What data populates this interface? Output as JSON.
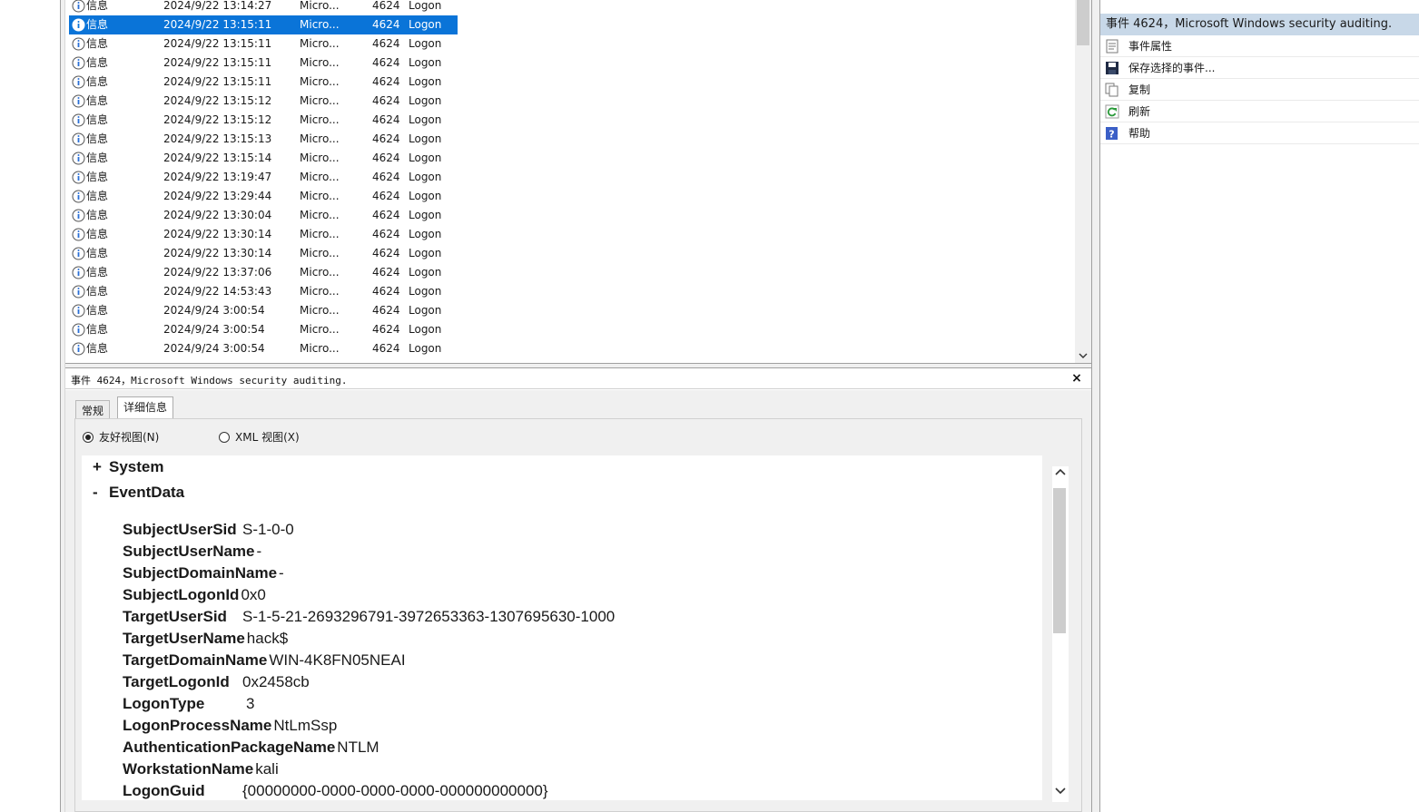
{
  "event_list": {
    "rows": [
      {
        "level": "信息",
        "date": "2024/9/22 13:14:27",
        "source": "Micro...",
        "event_id": "4624",
        "task": "Logon",
        "selected": false
      },
      {
        "level": "信息",
        "date": "2024/9/22 13:15:11",
        "source": "Micro...",
        "event_id": "4624",
        "task": "Logon",
        "selected": true
      },
      {
        "level": "信息",
        "date": "2024/9/22 13:15:11",
        "source": "Micro...",
        "event_id": "4624",
        "task": "Logon",
        "selected": false
      },
      {
        "level": "信息",
        "date": "2024/9/22 13:15:11",
        "source": "Micro...",
        "event_id": "4624",
        "task": "Logon",
        "selected": false
      },
      {
        "level": "信息",
        "date": "2024/9/22 13:15:11",
        "source": "Micro...",
        "event_id": "4624",
        "task": "Logon",
        "selected": false
      },
      {
        "level": "信息",
        "date": "2024/9/22 13:15:12",
        "source": "Micro...",
        "event_id": "4624",
        "task": "Logon",
        "selected": false
      },
      {
        "level": "信息",
        "date": "2024/9/22 13:15:12",
        "source": "Micro...",
        "event_id": "4624",
        "task": "Logon",
        "selected": false
      },
      {
        "level": "信息",
        "date": "2024/9/22 13:15:13",
        "source": "Micro...",
        "event_id": "4624",
        "task": "Logon",
        "selected": false
      },
      {
        "level": "信息",
        "date": "2024/9/22 13:15:14",
        "source": "Micro...",
        "event_id": "4624",
        "task": "Logon",
        "selected": false
      },
      {
        "level": "信息",
        "date": "2024/9/22 13:19:47",
        "source": "Micro...",
        "event_id": "4624",
        "task": "Logon",
        "selected": false
      },
      {
        "level": "信息",
        "date": "2024/9/22 13:29:44",
        "source": "Micro...",
        "event_id": "4624",
        "task": "Logon",
        "selected": false
      },
      {
        "level": "信息",
        "date": "2024/9/22 13:30:04",
        "source": "Micro...",
        "event_id": "4624",
        "task": "Logon",
        "selected": false
      },
      {
        "level": "信息",
        "date": "2024/9/22 13:30:14",
        "source": "Micro...",
        "event_id": "4624",
        "task": "Logon",
        "selected": false
      },
      {
        "level": "信息",
        "date": "2024/9/22 13:30:14",
        "source": "Micro...",
        "event_id": "4624",
        "task": "Logon",
        "selected": false
      },
      {
        "level": "信息",
        "date": "2024/9/22 13:37:06",
        "source": "Micro...",
        "event_id": "4624",
        "task": "Logon",
        "selected": false
      },
      {
        "level": "信息",
        "date": "2024/9/22 14:53:43",
        "source": "Micro...",
        "event_id": "4624",
        "task": "Logon",
        "selected": false
      },
      {
        "level": "信息",
        "date": "2024/9/24 3:00:54",
        "source": "Micro...",
        "event_id": "4624",
        "task": "Logon",
        "selected": false
      },
      {
        "level": "信息",
        "date": "2024/9/24 3:00:54",
        "source": "Micro...",
        "event_id": "4624",
        "task": "Logon",
        "selected": false
      },
      {
        "level": "信息",
        "date": "2024/9/24 3:00:54",
        "source": "Micro...",
        "event_id": "4624",
        "task": "Logon",
        "selected": false
      }
    ]
  },
  "detail": {
    "title": "事件 4624，Microsoft Windows security auditing.",
    "close_label": "×",
    "tabs": [
      "常规",
      "详细信息"
    ],
    "views": {
      "friendly": "友好视图(N)",
      "xml": "XML 视图(X)"
    },
    "tree": {
      "system": {
        "toggle": "+",
        "label": "System"
      },
      "eventdata": {
        "toggle": "-",
        "label": "EventData"
      }
    },
    "fields": [
      {
        "name": "SubjectUserSid",
        "value": "S-1-0-0"
      },
      {
        "name": "SubjectUserName",
        "value": "-"
      },
      {
        "name": "SubjectDomainName",
        "value": "-"
      },
      {
        "name": "SubjectLogonId",
        "value": "0x0"
      },
      {
        "name": "TargetUserSid",
        "value": "S-1-5-21-2693296791-3972653363-1307695630-1000"
      },
      {
        "name": "TargetUserName",
        "value": "hack$"
      },
      {
        "name": "TargetDomainName",
        "value": "WIN-4K8FN05NEAI"
      },
      {
        "name": "TargetLogonId",
        "value": "0x2458cb"
      },
      {
        "name": "LogonType",
        "value": "3"
      },
      {
        "name": "LogonProcessName",
        "value": "NtLmSsp"
      },
      {
        "name": "AuthenticationPackageName",
        "value": "NTLM"
      },
      {
        "name": "WorkstationName",
        "value": "kali"
      },
      {
        "name": "LogonGuid",
        "value": "{00000000-0000-0000-0000-000000000000}"
      }
    ]
  },
  "actions": {
    "section_title": "事件 4624，Microsoft Windows security auditing.",
    "items": [
      {
        "label": "事件属性",
        "icon": "properties-icon"
      },
      {
        "label": "保存选择的事件...",
        "icon": "save-icon"
      },
      {
        "label": "复制",
        "icon": "copy-icon"
      },
      {
        "label": "刷新",
        "icon": "refresh-icon"
      },
      {
        "label": "帮助",
        "icon": "help-icon"
      }
    ]
  },
  "colors": {
    "selection": "#0a74d8",
    "section_header": "#c8d8e8",
    "info_icon": "#2a6fd6"
  }
}
